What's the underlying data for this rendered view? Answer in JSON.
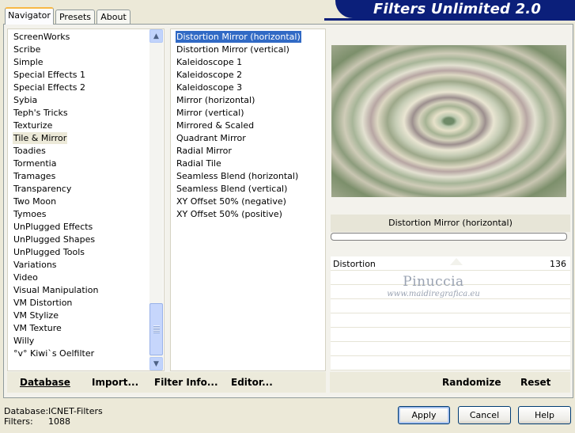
{
  "title": "Filters Unlimited 2.0",
  "tabs": [
    {
      "label": "Navigator",
      "active": true
    },
    {
      "label": "Presets",
      "active": false
    },
    {
      "label": "About",
      "active": false
    }
  ],
  "categories": [
    "ScreenWorks",
    "Scribe",
    "Simple",
    "Special Effects 1",
    "Special Effects 2",
    "Sybia",
    "Teph's Tricks",
    "Texturize",
    "Tile & Mirror",
    "Toadies",
    "Tormentia",
    "Tramages",
    "Transparency",
    "Two Moon",
    "Tymoes",
    "UnPlugged Effects",
    "UnPlugged Shapes",
    "UnPlugged Tools",
    "Variations",
    "Video",
    "Visual Manipulation",
    "VM Distortion",
    "VM Stylize",
    "VM Texture",
    "Willy",
    "°v° Kiwi`s Oelfilter"
  ],
  "selected_category": "Tile & Mirror",
  "filters": [
    "Distortion Mirror (horizontal)",
    "Distortion Mirror (vertical)",
    "Kaleidoscope 1",
    "Kaleidoscope 2",
    "Kaleidoscope 3",
    "Mirror (horizontal)",
    "Mirror (vertical)",
    "Mirrored & Scaled",
    "Quadrant Mirror",
    "Radial Mirror",
    "Radial Tile",
    "Seamless Blend (horizontal)",
    "Seamless Blend (vertical)",
    "XY Offset 50% (negative)",
    "XY Offset 50% (positive)"
  ],
  "selected_filter": "Distortion Mirror (horizontal)",
  "preview": {
    "filter_name": "Distortion Mirror (horizontal)",
    "param_name": "Distortion",
    "param_value": "136",
    "watermark_name": "Pinuccia",
    "watermark_url": "www.maidiregrafica.eu"
  },
  "toolbar": {
    "database": "Database",
    "import": "Import...",
    "filter_info": "Filter Info...",
    "editor": "Editor...",
    "randomize": "Randomize",
    "reset": "Reset"
  },
  "status": {
    "database_label": "Database:",
    "database_value": "ICNET-Filters",
    "filters_label": "Filters:",
    "filters_value": "1088"
  },
  "buttons": {
    "apply": "Apply",
    "cancel": "Cancel",
    "help": "Help"
  },
  "colors": {
    "banner": "#0b1f7a",
    "selection": "#316ac5",
    "tab_highlight": "#f8b845"
  }
}
